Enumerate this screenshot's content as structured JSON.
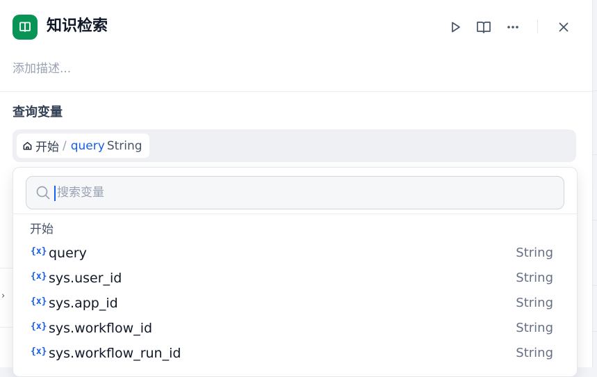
{
  "header": {
    "icon": "book-icon",
    "title": "知识检索",
    "run_icon": "play-icon",
    "docs_icon": "book-open-icon",
    "more_icon": "more-icon",
    "close_icon": "close-icon",
    "accent_color": "#079455"
  },
  "description": {
    "placeholder": "添加描述..."
  },
  "query_variable": {
    "label": "查询变量",
    "selected": {
      "node_icon": "home-icon",
      "node": "开始",
      "separator": "/",
      "variable": "query",
      "type": "String"
    }
  },
  "dropdown": {
    "search_placeholder": "搜索变量",
    "group_label": "开始",
    "var_icon_text": "{x}",
    "items": [
      {
        "name": "query",
        "type": "String"
      },
      {
        "name": "sys.user_id",
        "type": "String"
      },
      {
        "name": "sys.app_id",
        "type": "String"
      },
      {
        "name": "sys.workflow_id",
        "type": "String"
      },
      {
        "name": "sys.workflow_run_id",
        "type": "String"
      }
    ]
  },
  "side": {
    "chevron": "›"
  }
}
